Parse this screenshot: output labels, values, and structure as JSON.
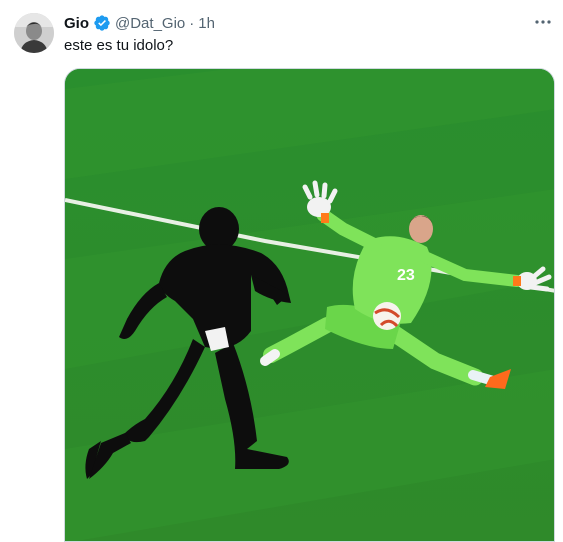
{
  "tweet": {
    "display_name": "Gio",
    "handle": "@Dat_Gio",
    "separator": "·",
    "time": "1h",
    "text": "este es tu idolo?",
    "jersey_number": "23"
  },
  "colors": {
    "verified": "#1d9bf0",
    "pitch": "#2f8a2a",
    "keeper_kit": "#7fe35a"
  },
  "icons": {
    "verified": "verified-badge-icon",
    "more": "more-options-icon"
  }
}
